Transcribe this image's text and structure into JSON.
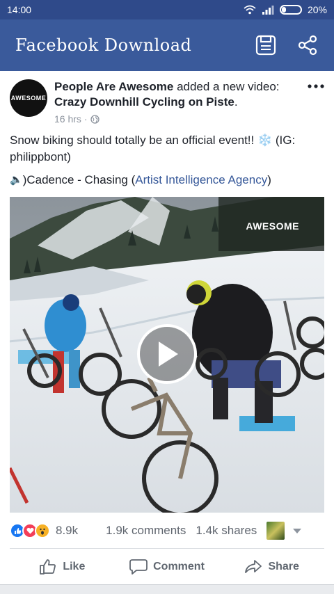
{
  "status_bar": {
    "time": "14:00",
    "battery": "20%"
  },
  "app_bar": {
    "title": "Facebook Download",
    "icons": [
      "save-icon",
      "share-icon"
    ]
  },
  "post": {
    "page_name": "People Are Awesome",
    "avatar_text": "AWESOME",
    "action_text": "added a new video:",
    "video_title": "Crazy Downhill Cycling on Piste",
    "title_suffix": ".",
    "time": "16 hrs",
    "separator": "·",
    "caption": "Snow biking should totally be an official event!!",
    "caption_emoji": "❄️",
    "caption_ig": "(IG: philippbont)",
    "music_icon": "🔈",
    "music_track": ")Cadence - Chasing (",
    "music_artist": "Artist Intelligence Agency",
    "music_close": ")",
    "video_watermark": "AWESOME",
    "reactions_count": "8.9k",
    "comments": "1.9k comments",
    "shares": "1.4k shares",
    "colors": {
      "link": "#365899",
      "appbar": "#3a5a9b",
      "statusbar": "#2f4a8a",
      "like": "#1877f2",
      "love": "#f33e58",
      "wow": "#f7b125"
    }
  },
  "actions": {
    "like": "Like",
    "comment": "Comment",
    "share": "Share"
  }
}
